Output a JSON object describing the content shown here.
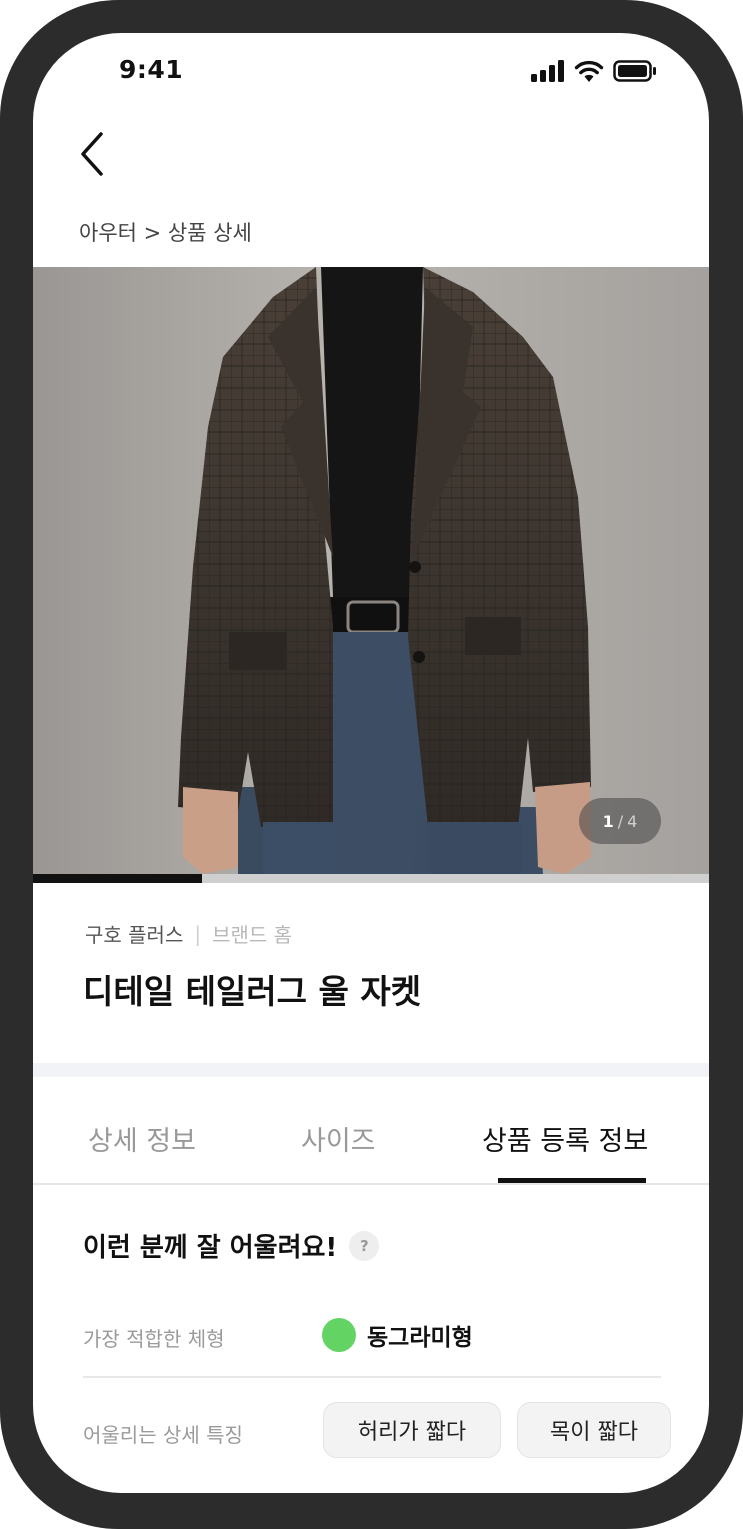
{
  "status_bar": {
    "time": "9:41",
    "icons": [
      "cellular-signal-icon",
      "wifi-icon",
      "battery-icon"
    ]
  },
  "nav": {
    "back_icon": "chevron-left-icon",
    "breadcrumb": "아우터 > 상품 상세"
  },
  "gallery": {
    "current": "1",
    "separator": "/",
    "total": "4",
    "progress": 0.25
  },
  "product": {
    "brand": "구호 플러스",
    "brand_home": "브랜드 홈",
    "name": "디테일 테일러그 울 자켓"
  },
  "tabs": [
    {
      "label": "상세 정보",
      "active": false
    },
    {
      "label": "사이즈",
      "active": false
    },
    {
      "label": "상품 등록 정보",
      "active": true
    }
  ],
  "fit": {
    "title": "이런 분께 잘 어울려요!",
    "help": "?",
    "best_body_label": "가장 적합한 체형",
    "best_body_value": "동그라미형",
    "best_body_color": "#63d463",
    "features_label": "어울리는 상세 특징",
    "features": [
      "허리가 짧다",
      "목이 짧다"
    ]
  }
}
